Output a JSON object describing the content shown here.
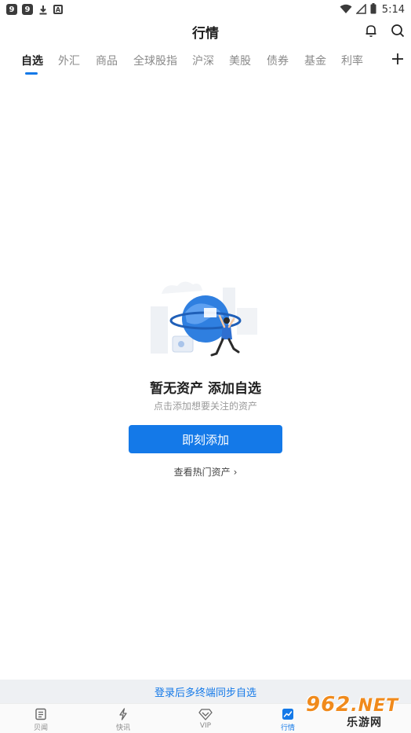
{
  "status_bar": {
    "app1": "9",
    "app2": "9",
    "download_icon": "download-icon",
    "a_icon": "A",
    "battery": "5",
    "time": "5:14"
  },
  "header": {
    "title": "行情",
    "bell_icon": "bell-icon",
    "search_icon": "search-icon"
  },
  "tabs": [
    "自选",
    "外汇",
    "商品",
    "全球股指",
    "沪深",
    "美股",
    "债券",
    "基金",
    "利率"
  ],
  "empty_state": {
    "title": "暂无资产 添加自选",
    "subtitle": "点击添加想要关注的资产",
    "add_button": "即刻添加",
    "hot_link": "查看热门资产",
    "hot_link_chevron": "›"
  },
  "login_banner": "登录后多终端同步自选",
  "bottom_nav": [
    {
      "label": "贝闻",
      "icon": "news-icon"
    },
    {
      "label": "快讯",
      "icon": "lightning-icon"
    },
    {
      "label": "VIP",
      "icon": "diamond-icon"
    },
    {
      "label": "行情",
      "icon": "chart-icon",
      "active": true
    }
  ],
  "watermark": {
    "logo": "962",
    "net": ".NET",
    "sub": "乐游网"
  },
  "colors": {
    "accent": "#1479e8",
    "watermark": "#f08a1c"
  }
}
